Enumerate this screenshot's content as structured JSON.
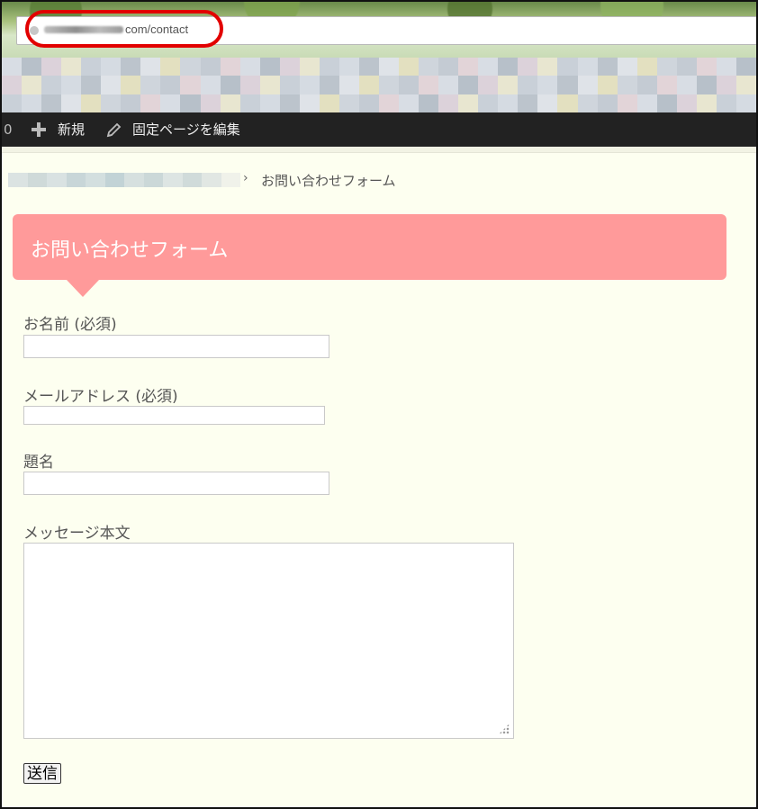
{
  "browser": {
    "url_visible": "com/contact"
  },
  "admin_bar": {
    "counter": "0",
    "new_label": "新規",
    "edit_page_label": "固定ページを編集"
  },
  "breadcrumb": {
    "separator": "›",
    "current": "お問い合わせフォーム"
  },
  "page": {
    "title": "お問い合わせフォーム",
    "title_color": "#ff9a9a"
  },
  "form": {
    "name_label": "お名前 (必須)",
    "email_label": "メールアドレス (必須)",
    "subject_label": "題名",
    "message_label": "メッセージ本文",
    "submit_label": "送信"
  },
  "annotation": {
    "highlight_color": "#e20000"
  }
}
